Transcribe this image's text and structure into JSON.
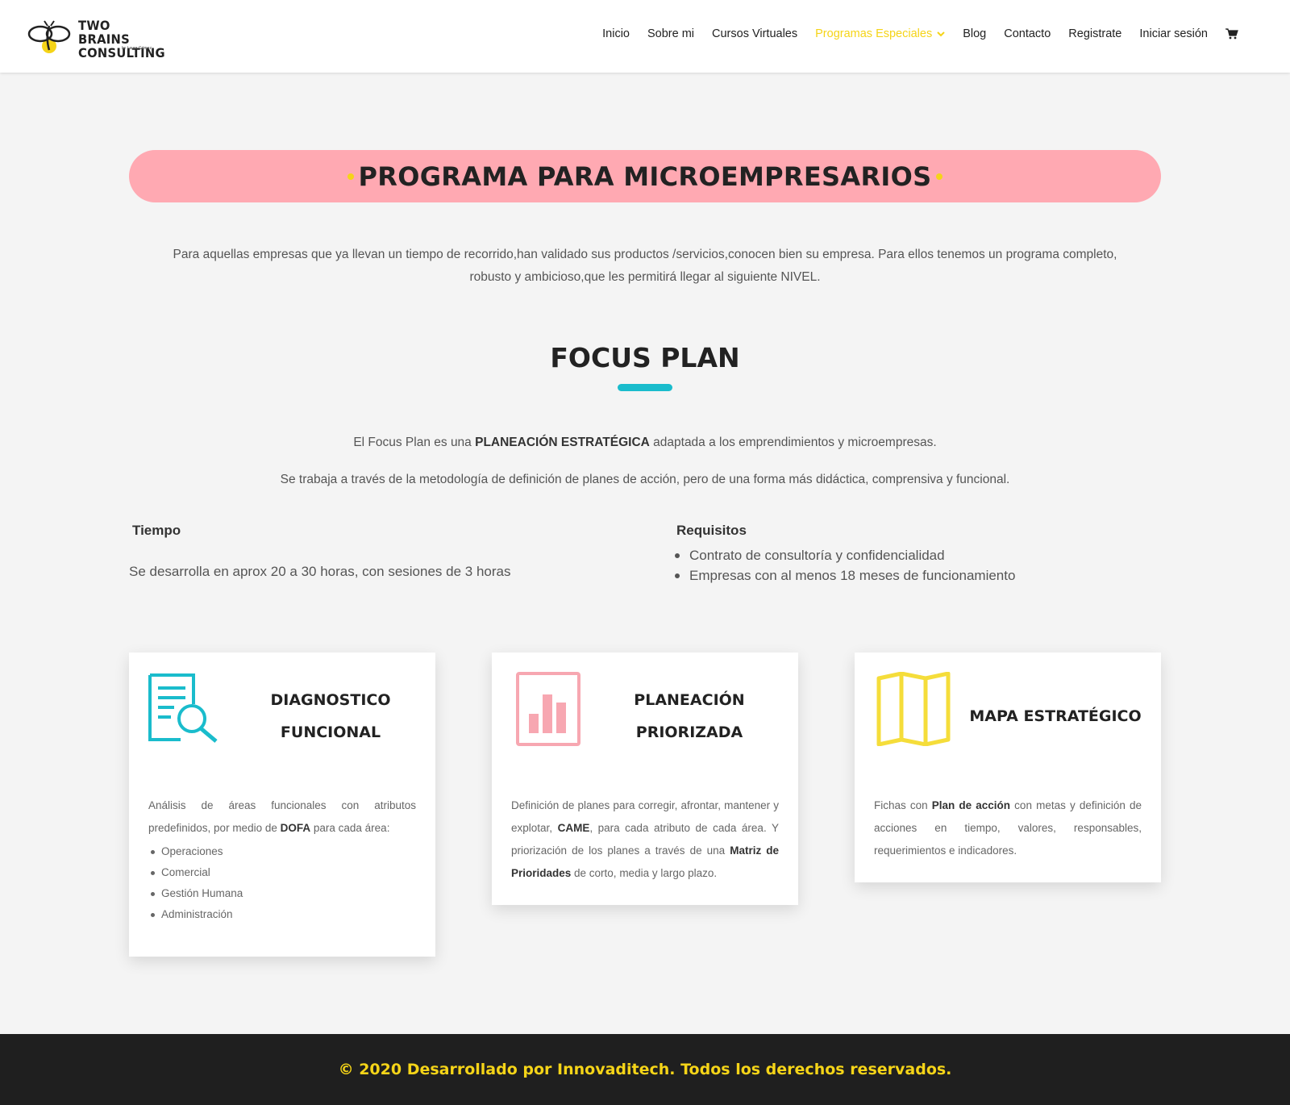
{
  "brand": {
    "name_line1": "TWO BRAINS",
    "name_line2": "CONSULTING",
    "tagline": "by Laura Gómez"
  },
  "nav": {
    "items": [
      {
        "label": "Inicio"
      },
      {
        "label": "Sobre mi"
      },
      {
        "label": "Cursos Virtuales"
      },
      {
        "label": "Programas Especiales",
        "active": true
      },
      {
        "label": "Blog"
      },
      {
        "label": "Contacto"
      },
      {
        "label": "Registrate"
      },
      {
        "label": "Iniciar sesión"
      }
    ],
    "cart_icon": "cart-icon",
    "dropdown_icon": "chevron-down-icon"
  },
  "colors": {
    "accent_yellow": "#f5d418",
    "banner_pink": "#ffa9b2",
    "teal": "#1abccc",
    "pink_icon": "#f7a7b1",
    "footer_bg": "#1f1f1f"
  },
  "banner": {
    "title": "PROGRAMA PARA MICROEMPRESARIOS"
  },
  "intro": {
    "text": "Para aquellas empresas que ya llevan un tiempo de recorrido,han validado sus productos /servicios,conocen bien su empresa. Para ellos tenemos un programa completo, robusto y ambicioso,que les permitirá llegar al siguiente NIVEL."
  },
  "focus": {
    "title": "FOCUS PLAN",
    "p1_pre": "El Focus Plan es una ",
    "p1_strong": "PLANEACIÓN ESTRATÉGICA",
    "p1_post": " adaptada a los emprendimientos y microempresas.",
    "p2": "Se trabaja a través de la metodología de definición de planes de acción, pero de una forma más didáctica, comprensiva y funcional."
  },
  "tiempo": {
    "heading": "Tiempo",
    "text": "Se desarrolla en aprox 20 a 30 horas, con sesiones de 3 horas"
  },
  "requisitos": {
    "heading": "Requisitos",
    "items": [
      "Contrato de consultoría y confidencialidad",
      "Empresas con al menos 18 meses de funcionamiento"
    ]
  },
  "cards": [
    {
      "icon": "document-search-icon",
      "title_line1": "DIAGNOSTICO",
      "title_line2": "FUNCIONAL",
      "text_pre": "Análisis de áreas funcionales con atributos predefinidos, por medio de ",
      "text_strong": "DOFA",
      "text_post": " para cada área:",
      "list": [
        "Operaciones",
        "Comercial",
        "Gestión Humana",
        "Administración"
      ]
    },
    {
      "icon": "bar-chart-icon",
      "title_line1": "PLANEACIÓN",
      "title_line2": "PRIORIZADA",
      "text_a": "Definición de planes para corregir, afrontar, mantener y explotar, ",
      "text_b": "CAME",
      "text_c": ", para cada atributo de cada área. Y priorización de los planes a través de una ",
      "text_d": "Matriz de Prioridades",
      "text_e": " de corto, media y largo plazo."
    },
    {
      "icon": "map-icon",
      "title": "MAPA ESTRATÉGICO",
      "text_pre": "Fichas con ",
      "text_strong": "Plan de acción",
      "text_post": " con metas y definición de acciones en tiempo, valores, responsables, requerimientos e indicadores."
    }
  ],
  "footer": {
    "text": "© 2020 Desarrollado por Innovaditech. Todos los derechos reservados."
  }
}
